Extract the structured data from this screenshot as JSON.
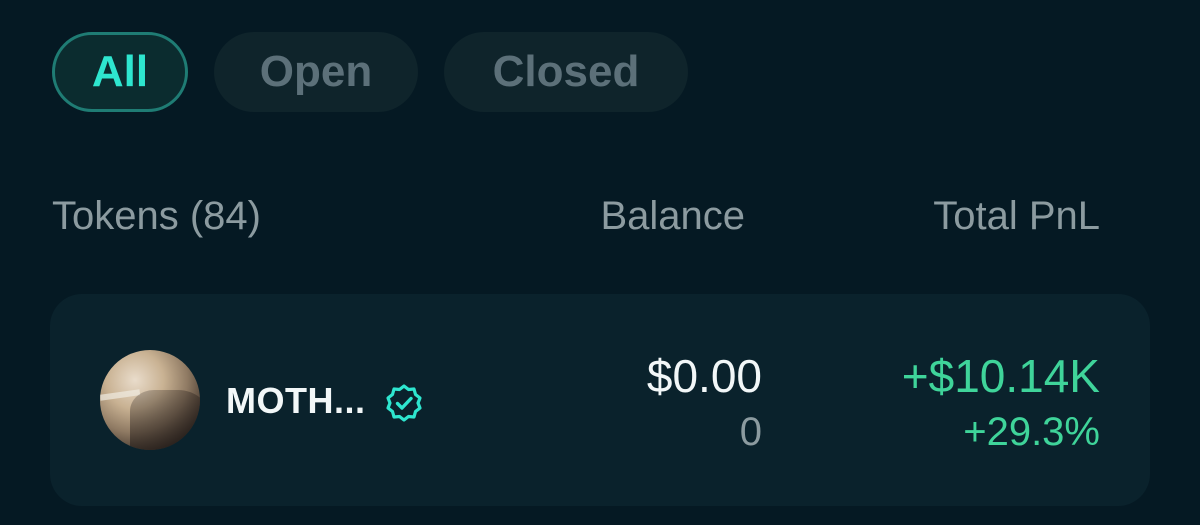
{
  "filters": {
    "tabs": [
      {
        "label": "All",
        "selected": true
      },
      {
        "label": "Open",
        "selected": false
      },
      {
        "label": "Closed",
        "selected": false
      }
    ]
  },
  "table": {
    "headers": {
      "tokens": "Tokens (84)",
      "balance": "Balance",
      "total_pnl": "Total PnL"
    },
    "rows": [
      {
        "name": "MOTH...",
        "verified": true,
        "balance_usd": "$0.00",
        "balance_amount": "0",
        "pnl_usd": "+$10.14K",
        "pnl_pct": "+29.3%"
      }
    ]
  },
  "icons": {
    "verified": "verified-badge-icon",
    "avatar": "token-avatar"
  },
  "colors": {
    "background": "#051923",
    "accent": "#2ee6cf",
    "positive": "#3fd49a",
    "muted_text": "#8c9ba0",
    "card": "#0a222c"
  }
}
